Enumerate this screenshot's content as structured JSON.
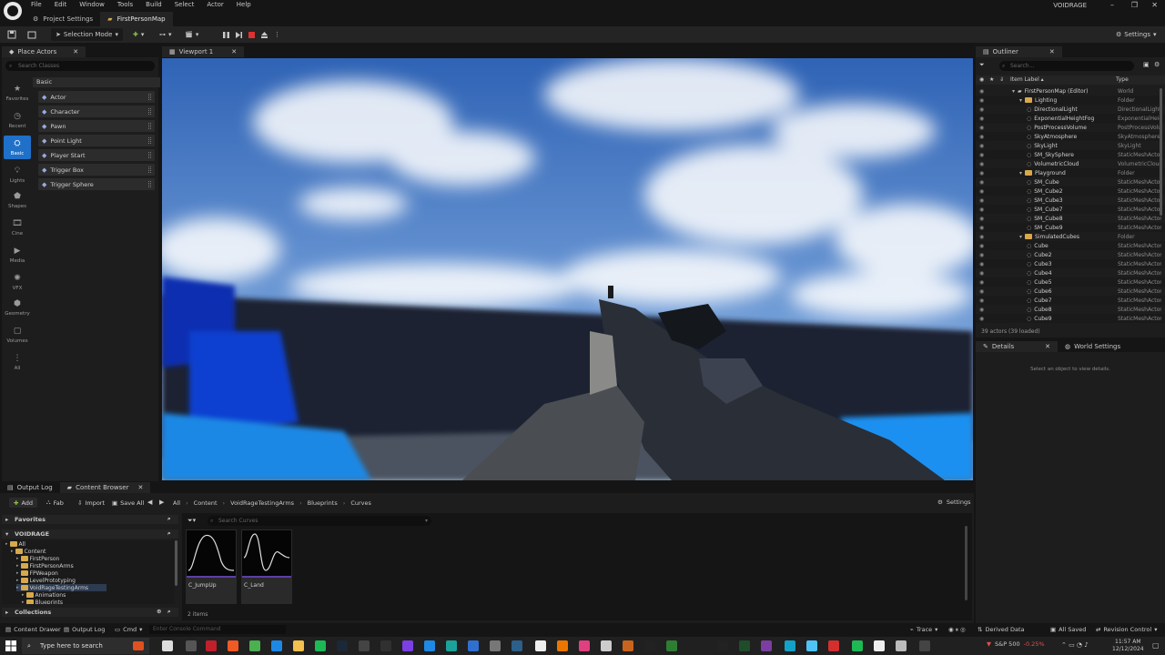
{
  "menubar": {
    "items": [
      "File",
      "Edit",
      "Window",
      "Tools",
      "Build",
      "Select",
      "Actor",
      "Help"
    ],
    "project_name": "VOIDRAGE"
  },
  "doc_tabs": [
    {
      "label": "Project Settings",
      "icon": "gear-icon"
    },
    {
      "label": "FirstPersonMap",
      "icon": "level-icon"
    }
  ],
  "toolbar": {
    "selection_mode": "Selection Mode",
    "settings": "Settings"
  },
  "place_actors": {
    "tab_label": "Place Actors",
    "search_placeholder": "Search Classes",
    "categories": [
      "Favorites",
      "Recent",
      "Basic",
      "Lights",
      "Shapes",
      "Cine",
      "Media",
      "VFX",
      "Geometry",
      "Volumes",
      "All"
    ],
    "active_category": "Basic",
    "section_header": "Basic",
    "actors": [
      "Actor",
      "Character",
      "Pawn",
      "Point Light",
      "Player Start",
      "Trigger Box",
      "Trigger Sphere"
    ]
  },
  "viewport": {
    "tab_label": "Viewport 1"
  },
  "outliner": {
    "tab_label": "Outliner",
    "search_placeholder": "Search...",
    "col_label": "Item Label ▴",
    "col_type": "Type",
    "rows": [
      {
        "indent": 0,
        "label": "FirstPersonMap (Editor)",
        "type": "World",
        "icon": "world"
      },
      {
        "indent": 1,
        "label": "Lighting",
        "type": "Folder",
        "icon": "folder"
      },
      {
        "indent": 2,
        "label": "DirectionalLight",
        "type": "DirectionalLight",
        "icon": "actor"
      },
      {
        "indent": 2,
        "label": "ExponentialHeightFog",
        "type": "ExponentialHeightFog",
        "icon": "actor"
      },
      {
        "indent": 2,
        "label": "PostProcessVolume",
        "type": "PostProcessVolume",
        "icon": "actor"
      },
      {
        "indent": 2,
        "label": "SkyAtmosphere",
        "type": "SkyAtmosphere",
        "icon": "actor"
      },
      {
        "indent": 2,
        "label": "SkyLight",
        "type": "SkyLight",
        "icon": "actor"
      },
      {
        "indent": 2,
        "label": "SM_SkySphere",
        "type": "StaticMeshActor",
        "icon": "actor"
      },
      {
        "indent": 2,
        "label": "VolumetricCloud",
        "type": "VolumetricCloud",
        "icon": "actor"
      },
      {
        "indent": 1,
        "label": "Playground",
        "type": "Folder",
        "icon": "folder"
      },
      {
        "indent": 2,
        "label": "SM_Cube",
        "type": "StaticMeshActor",
        "icon": "actor"
      },
      {
        "indent": 2,
        "label": "SM_Cube2",
        "type": "StaticMeshActor",
        "icon": "actor"
      },
      {
        "indent": 2,
        "label": "SM_Cube3",
        "type": "StaticMeshActor",
        "icon": "actor"
      },
      {
        "indent": 2,
        "label": "SM_Cube7",
        "type": "StaticMeshActor",
        "icon": "actor"
      },
      {
        "indent": 2,
        "label": "SM_Cube8",
        "type": "StaticMeshActor",
        "icon": "actor"
      },
      {
        "indent": 2,
        "label": "SM_Cube9",
        "type": "StaticMeshActor",
        "icon": "actor"
      },
      {
        "indent": 1,
        "label": "SimulatedCubes",
        "type": "Folder",
        "icon": "folder"
      },
      {
        "indent": 2,
        "label": "Cube",
        "type": "StaticMeshActor",
        "icon": "actor"
      },
      {
        "indent": 2,
        "label": "Cube2",
        "type": "StaticMeshActor",
        "icon": "actor"
      },
      {
        "indent": 2,
        "label": "Cube3",
        "type": "StaticMeshActor",
        "icon": "actor"
      },
      {
        "indent": 2,
        "label": "Cube4",
        "type": "StaticMeshActor",
        "icon": "actor"
      },
      {
        "indent": 2,
        "label": "Cube5",
        "type": "StaticMeshActor",
        "icon": "actor"
      },
      {
        "indent": 2,
        "label": "Cube6",
        "type": "StaticMeshActor",
        "icon": "actor"
      },
      {
        "indent": 2,
        "label": "Cube7",
        "type": "StaticMeshActor",
        "icon": "actor"
      },
      {
        "indent": 2,
        "label": "Cube8",
        "type": "StaticMeshActor",
        "icon": "actor"
      },
      {
        "indent": 2,
        "label": "Cube9",
        "type": "StaticMeshActor",
        "icon": "actor"
      }
    ],
    "footer": "39 actors (39 loaded)"
  },
  "details": {
    "tab_label": "Details",
    "world_settings_tab": "World Settings",
    "empty_text": "Select an object to view details."
  },
  "bottom": {
    "tabs": [
      "Output Log",
      "Content Browser"
    ],
    "add": "Add",
    "fab": "Fab",
    "import": "Import",
    "save_all": "Save All",
    "breadcrumb": [
      "All",
      "Content",
      "VoidRageTestingArms",
      "Blueprints",
      "Curves"
    ],
    "settings": "Settings",
    "favorites": "Favorites",
    "project_root": "VOIDRAGE",
    "tree": [
      {
        "indent": 0,
        "label": "All"
      },
      {
        "indent": 1,
        "label": "Content"
      },
      {
        "indent": 2,
        "label": "FirstPerson"
      },
      {
        "indent": 2,
        "label": "FirstPersonArms"
      },
      {
        "indent": 2,
        "label": "FPWeapon"
      },
      {
        "indent": 2,
        "label": "LevelPrototyping"
      },
      {
        "indent": 2,
        "label": "VoidRageTestingArms"
      },
      {
        "indent": 3,
        "label": "Animations"
      },
      {
        "indent": 3,
        "label": "Blueprints"
      }
    ],
    "collections": "Collections",
    "asset_search_placeholder": "Search Curves",
    "assets": [
      {
        "name": "C_JumpUp"
      },
      {
        "name": "C_Land"
      }
    ],
    "item_count": "2 items"
  },
  "statusbar": {
    "content_drawer": "Content Drawer",
    "output_log": "Output Log",
    "cmd": "Cmd",
    "console_placeholder": "Enter Console Command",
    "trace": "Trace",
    "derived_data": "Derived Data",
    "all_saved": "All Saved",
    "revision_control": "Revision Control"
  },
  "taskbar": {
    "search_placeholder": "Type here to search",
    "stock": "S&P 500",
    "stock_change": "-0.25%",
    "time": "11:57 AM",
    "date": "12/12/2024"
  },
  "colors": {
    "accent_blue": "#1f70c8",
    "folder_yellow": "#d7a94b",
    "stop_red": "#e03030",
    "asset_purple": "#5b3fa6"
  }
}
